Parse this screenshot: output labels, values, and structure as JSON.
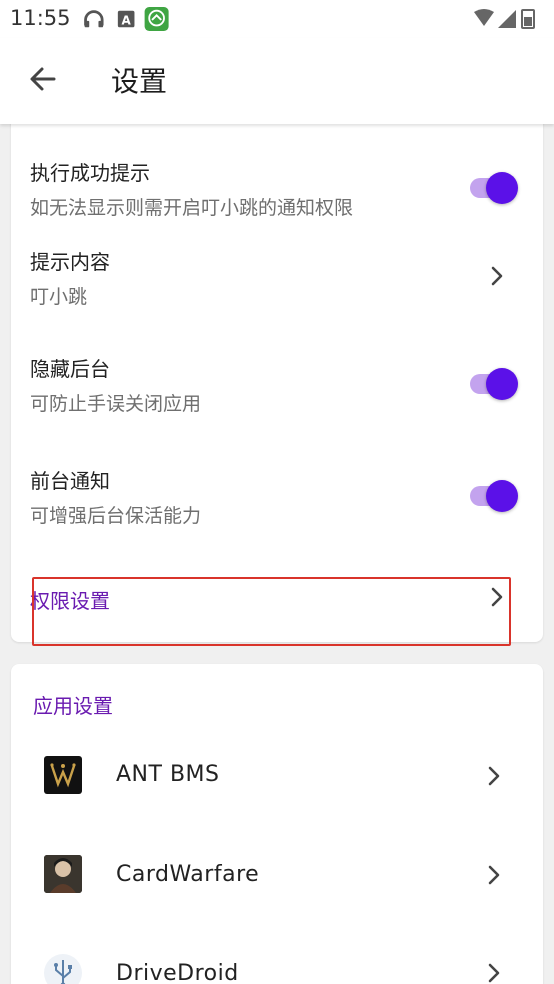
{
  "status_bar": {
    "time": "11:55"
  },
  "app_bar": {
    "title": "设置"
  },
  "settings": [
    {
      "title": "执行成功提示",
      "subtitle": "如无法显示则需开启叮小跳的通知权限",
      "control": "toggle",
      "on": true
    },
    {
      "title": "提示内容",
      "subtitle": "叮小跳",
      "control": "chevron"
    },
    {
      "title": "隐藏后台",
      "subtitle": "可防止手误关闭应用",
      "control": "toggle",
      "on": true
    },
    {
      "title": "前台通知",
      "subtitle": "可增强后台保活能力",
      "control": "toggle",
      "on": true
    },
    {
      "title": "权限设置",
      "control": "chevron"
    }
  ],
  "app_section": {
    "header": "应用设置",
    "apps": [
      {
        "name": "ANT BMS",
        "icon": "ant-bms-logo"
      },
      {
        "name": "CardWarfare",
        "icon": "cardwarfare-avatar"
      },
      {
        "name": "DriveDroid",
        "icon": "usb-icon"
      }
    ]
  },
  "colors": {
    "accent": "#6a1bb0",
    "toggle_knob": "#5b11e8",
    "toggle_track": "#c3a3ee",
    "highlight": "#d9342b"
  }
}
